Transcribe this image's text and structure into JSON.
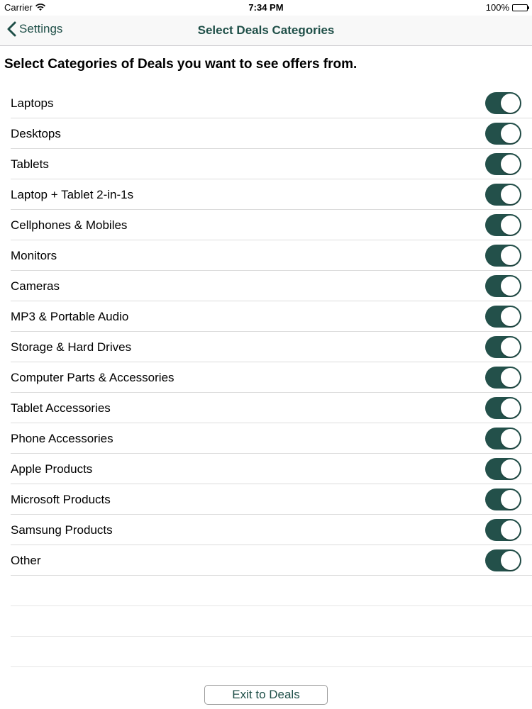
{
  "status_bar": {
    "carrier": "Carrier",
    "time": "7:34 PM",
    "battery": "100%"
  },
  "nav": {
    "back_label": "Settings",
    "title": "Select Deals Categories"
  },
  "instruction": "Select Categories of Deals you want to see offers from.",
  "categories": [
    {
      "label": "Laptops",
      "enabled": true
    },
    {
      "label": "Desktops",
      "enabled": true
    },
    {
      "label": "Tablets",
      "enabled": true
    },
    {
      "label": "Laptop + Tablet 2-in-1s",
      "enabled": true
    },
    {
      "label": "Cellphones & Mobiles",
      "enabled": true
    },
    {
      "label": "Monitors",
      "enabled": true
    },
    {
      "label": "Cameras",
      "enabled": true
    },
    {
      "label": "MP3 & Portable Audio",
      "enabled": true
    },
    {
      "label": "Storage & Hard Drives",
      "enabled": true
    },
    {
      "label": "Computer Parts & Accessories",
      "enabled": true
    },
    {
      "label": "Tablet Accessories",
      "enabled": true
    },
    {
      "label": "Phone Accessories",
      "enabled": true
    },
    {
      "label": "Apple Products",
      "enabled": true
    },
    {
      "label": "Microsoft Products",
      "enabled": true
    },
    {
      "label": "Samsung Products",
      "enabled": true
    },
    {
      "label": "Other",
      "enabled": true
    }
  ],
  "footer": {
    "exit_label": "Exit to Deals"
  },
  "colors": {
    "accent": "#1f4f48",
    "switch_on": "#23504a"
  }
}
